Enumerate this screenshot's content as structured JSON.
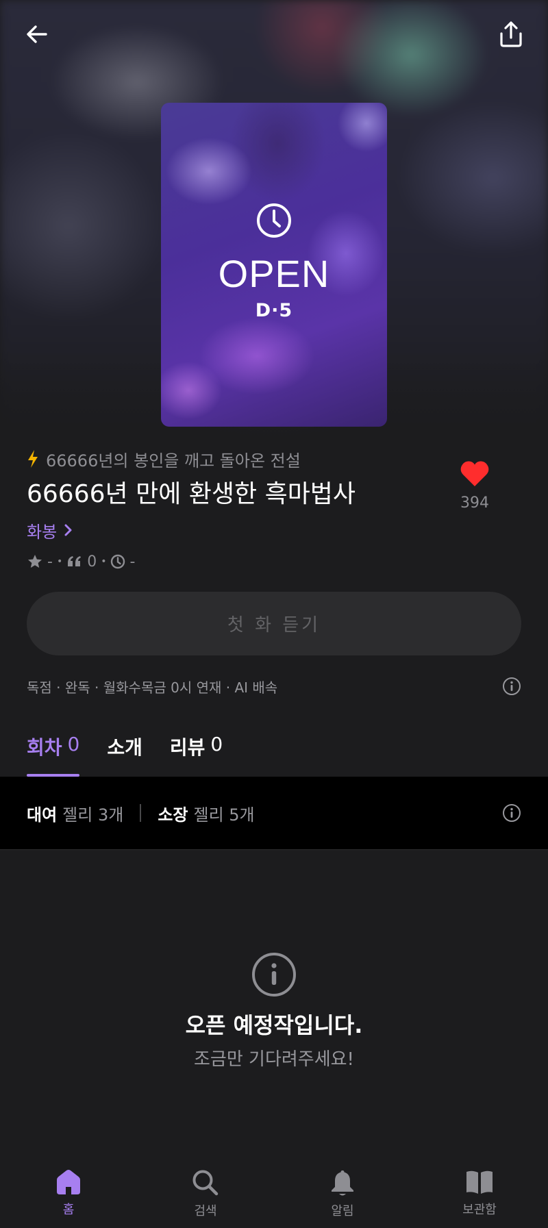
{
  "header": {
    "back_icon": "arrow-left-icon",
    "share_icon": "share-upload-icon"
  },
  "cover": {
    "clock_icon": "clock-icon",
    "open_label": "OPEN",
    "dday_label": "D·5"
  },
  "work": {
    "tagline": "66666년의 봉인을 깨고 돌아온 전설",
    "title": "66666년 만에 환생한 흑마법사",
    "author": "화봉",
    "rating": "-",
    "reviews": "0",
    "time": "-",
    "like_count": "394",
    "accent_color": "#a77ff0",
    "like_color": "#ff2d2d"
  },
  "actions": {
    "listen_label": "첫 화 듣기"
  },
  "meta": {
    "text": "독점 · 완독 · 월화수목금 0시 연재 · AI 배속"
  },
  "tabs": [
    {
      "label": "회차",
      "count": "0"
    },
    {
      "label": "소개",
      "count": ""
    },
    {
      "label": "리뷰",
      "count": "0"
    }
  ],
  "price": {
    "rent_label": "대여",
    "rent_value": "젤리 3개",
    "own_label": "소장",
    "own_value": "젤리 5개"
  },
  "empty": {
    "title": "오픈 예정작입니다.",
    "subtitle": "조금만 기다려주세요!"
  },
  "nav": [
    {
      "label": "홈",
      "icon": "home-icon"
    },
    {
      "label": "검색",
      "icon": "search-icon"
    },
    {
      "label": "알림",
      "icon": "bell-icon"
    },
    {
      "label": "보관함",
      "icon": "book-icon"
    }
  ]
}
